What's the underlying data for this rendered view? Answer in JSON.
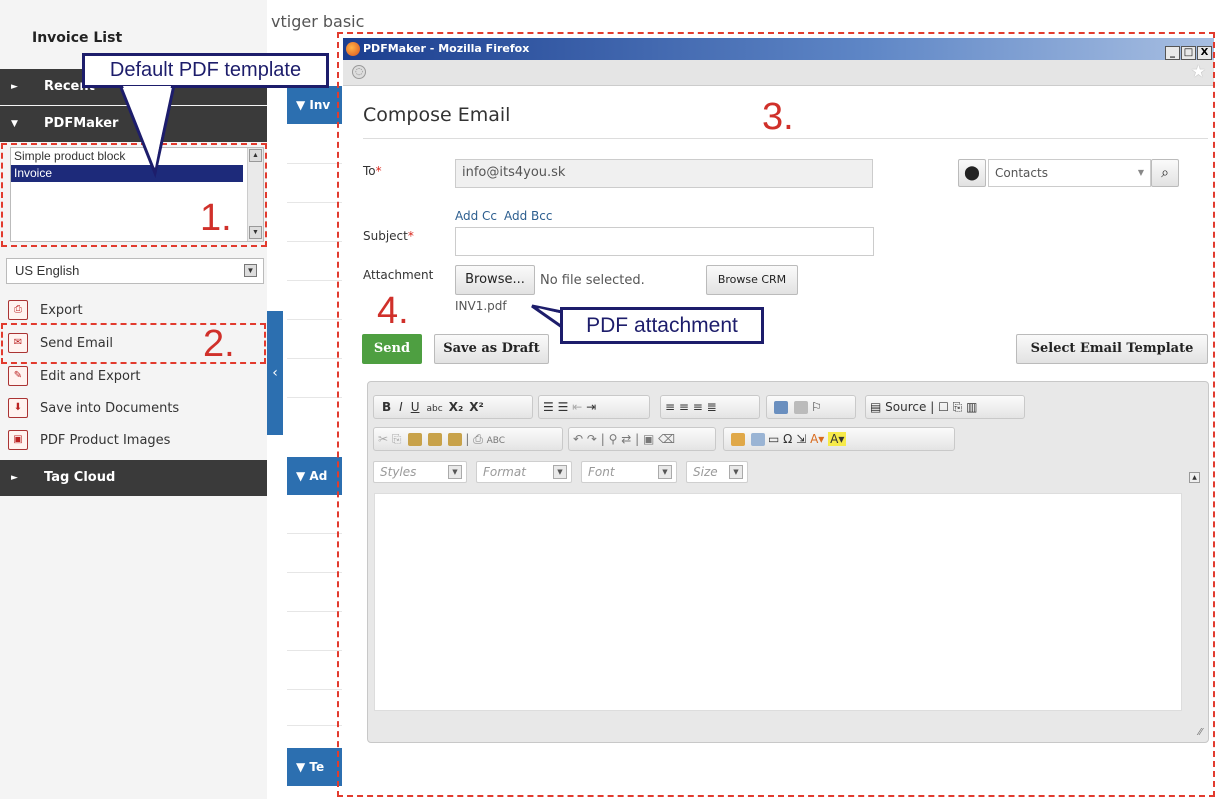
{
  "app": {
    "header": "vtiger basic"
  },
  "sidebar": {
    "title": "Invoice List",
    "sections": [
      {
        "label": "Recent",
        "expanded": false
      },
      {
        "label": "PDFMaker",
        "expanded": true
      },
      {
        "label": "Tag Cloud",
        "expanded": false
      }
    ],
    "templates": [
      "Simple product block",
      "Invoice"
    ],
    "selected_template": "Invoice",
    "language": "US English",
    "actions": [
      {
        "label": "Export",
        "icon": "pdf-icon"
      },
      {
        "label": "Send Email",
        "icon": "email-pdf-icon"
      },
      {
        "label": "Edit and Export",
        "icon": "edit-pdf-icon"
      },
      {
        "label": "Save into Documents",
        "icon": "save-pdf-icon"
      },
      {
        "label": "PDF Product Images",
        "icon": "image-pdf-icon"
      }
    ]
  },
  "background_panels": [
    "Inv",
    "Ad",
    "Te"
  ],
  "popup": {
    "window_title": "PDFMaker - Mozilla Firefox",
    "window_buttons": [
      "_",
      "□",
      "X"
    ],
    "heading": "Compose Email",
    "to": {
      "label": "To",
      "required_mark": "*",
      "value": "info@its4you.sk"
    },
    "recipient_type": "Contacts",
    "add_cc": "Add Cc",
    "add_bcc": "Add Bcc",
    "subject": {
      "label": "Subject",
      "required_mark": "*",
      "value": ""
    },
    "attachment": {
      "label": "Attachment",
      "browse": "Browse...",
      "no_file": "No file selected.",
      "browse_crm": "Browse CRM",
      "file": "INV1.pdf"
    },
    "send": "Send",
    "save_draft": "Save as Draft",
    "select_template": "Select Email Template",
    "toolbar": {
      "bold": "B",
      "italic": "I",
      "underline": "U",
      "subscript": "X₂",
      "superscript": "X²",
      "source": "Source",
      "styles": "Styles",
      "format": "Format",
      "font": "Font",
      "size": "Size"
    }
  },
  "annotations": {
    "default_pdf": "Default PDF template",
    "pdf_attachment": "PDF attachment",
    "step1": "1.",
    "step2": "2.",
    "step3": "3.",
    "step4": "4."
  },
  "colors": {
    "sidebar_dark": "#3a3a3a",
    "accent_blue": "#2c6fb0",
    "send_green": "#4e9f41",
    "annotation_red": "#e23b2e",
    "annotation_navy": "#1d1d6b"
  }
}
